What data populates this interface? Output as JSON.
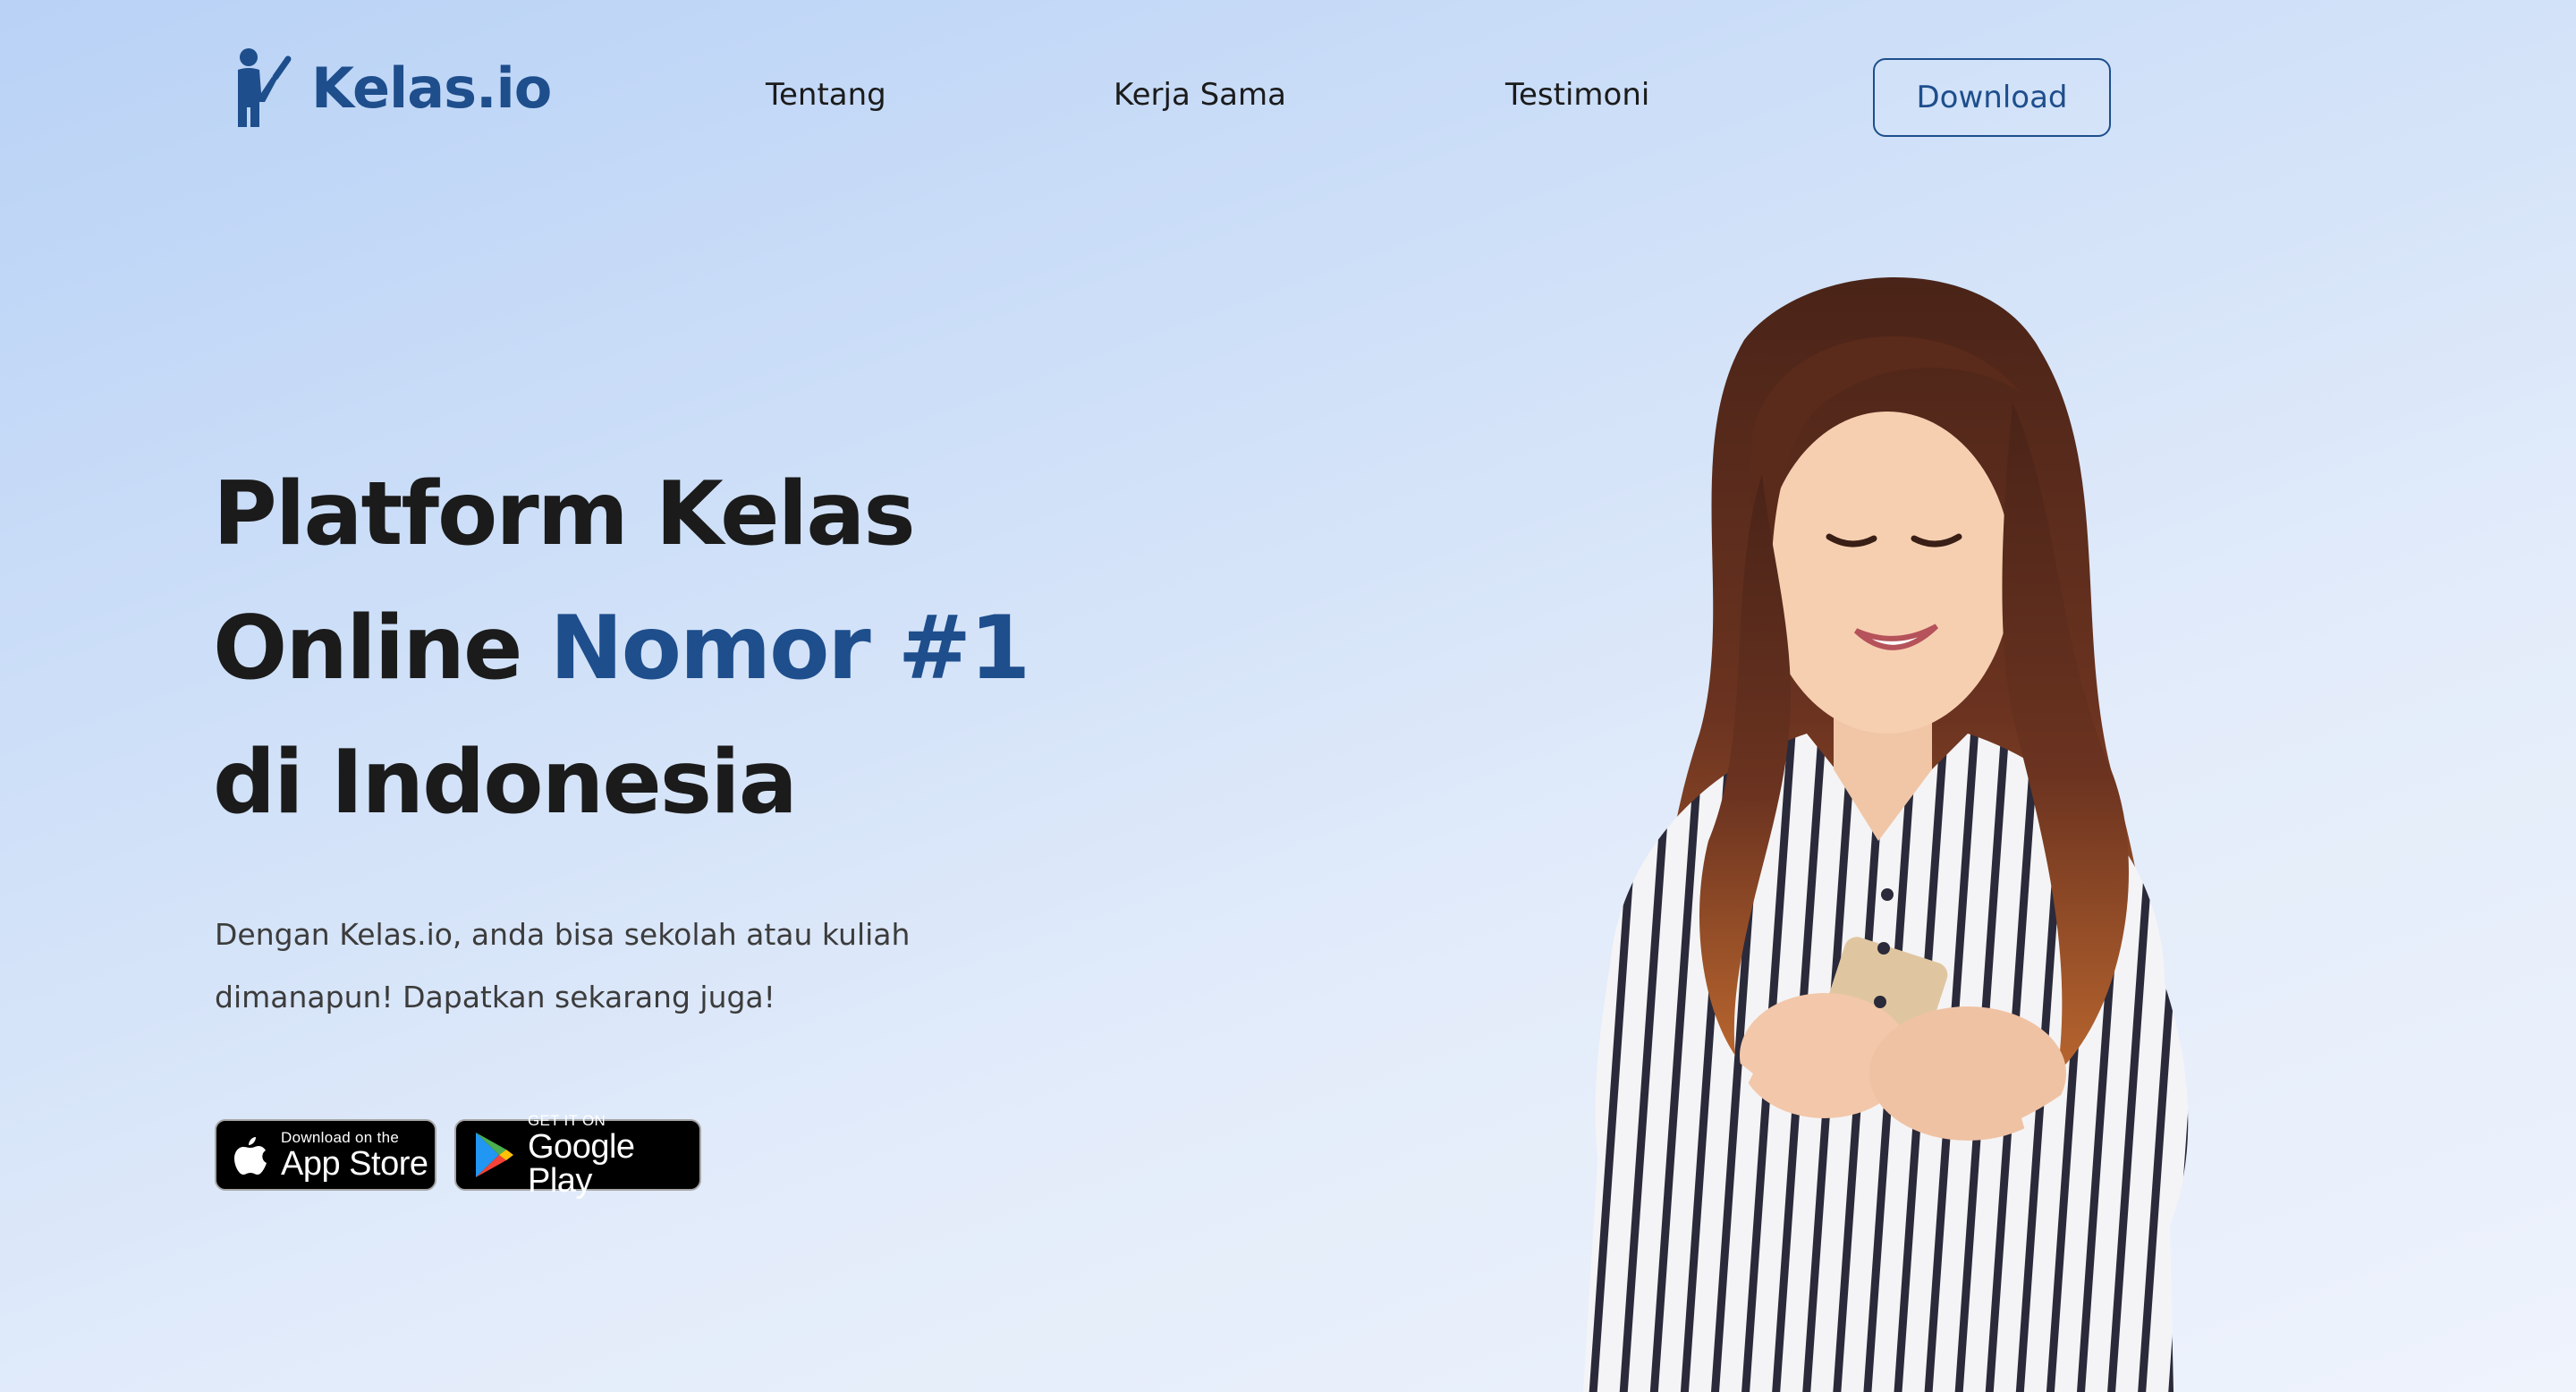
{
  "header": {
    "logo_text": "Kelas.io",
    "logo_icon": "person-presenting-icon",
    "nav": [
      {
        "label": "Tentang"
      },
      {
        "label": "Kerja Sama"
      },
      {
        "label": "Testimoni"
      }
    ],
    "download_label": "Download"
  },
  "hero": {
    "title_part1": "Platform Kelas",
    "title_part2": "Online ",
    "title_accent": "Nomor #1",
    "title_part3": "di Indonesia",
    "description_line1": "Dengan Kelas.io, anda bisa sekolah atau kuliah",
    "description_line2": "dimanapun! Dapatkan sekarang juga!",
    "image_icon": "woman-using-phone-illustration"
  },
  "stores": {
    "apple": {
      "small": "Download on the",
      "big": "App Store",
      "icon": "apple-icon"
    },
    "google": {
      "small": "GET IT ON",
      "big": "Google Play",
      "icon": "google-play-icon"
    }
  },
  "colors": {
    "brand": "#1e4e8c",
    "text": "#1b1b1b",
    "muted_text": "#3c3c3c",
    "background_start": "#b9d2f6",
    "background_end": "#eef3fc"
  }
}
